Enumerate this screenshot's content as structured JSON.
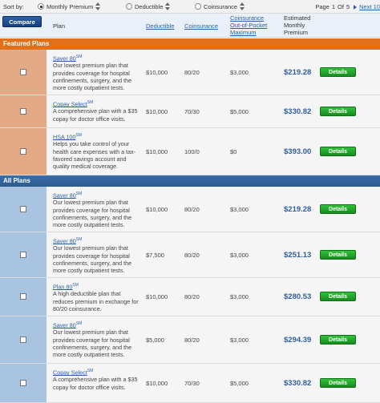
{
  "sortbar": {
    "label": "Sort by:",
    "options": [
      {
        "label": "Monthly Premium",
        "selected": true
      },
      {
        "label": "Deductible",
        "selected": false
      },
      {
        "label": "Coinsurance",
        "selected": false
      }
    ],
    "pager": {
      "page": "Page",
      "current": "1",
      "of": "Of",
      "total": "5",
      "next": "Next 10"
    }
  },
  "header": {
    "compare": "Compare",
    "plan": "Plan",
    "deductible": "Deductible",
    "coinsurance": "Coinsurance",
    "oop": [
      "Coinsurance",
      "Out-of-Pocket",
      "Maximum"
    ],
    "premium": [
      "Estimated",
      "Monthly",
      "Premium"
    ]
  },
  "sections": {
    "featured": "Featured Plans",
    "all": "All Plans"
  },
  "details_label": "Details",
  "featured_rows": [
    {
      "name": "Saver 80",
      "sm": "SM",
      "desc": [
        "Our lowest premium plan that",
        "provides coverage for hospital",
        "confinements, surgery, and the",
        "more costly outpatient tests."
      ],
      "deductible": "$10,000",
      "coinsurance": "80/20",
      "oop": "$3,000",
      "premium": "$219.28"
    },
    {
      "name": "Copay Select",
      "sm": "SM",
      "desc": [
        "A comprehensive plan with a $35",
        "copay for doctor office visits."
      ],
      "deductible": "$10,000",
      "coinsurance": "70/30",
      "oop": "$5,000",
      "premium": "$330.82"
    },
    {
      "name": "HSA 100",
      "sm": "SM",
      "desc": [
        "Helps you take control of your",
        "health care expenses with a tax-",
        "favored savings account and",
        "quality medical coverage."
      ],
      "deductible": "$10,000",
      "coinsurance": "100/0",
      "oop": "$0",
      "premium": "$393.00"
    }
  ],
  "all_rows": [
    {
      "name": "Saver 80",
      "sm": "SM",
      "desc": [
        "Our lowest premium plan that",
        "provides coverage for hospital",
        "confinements, surgery, and the",
        "more costly outpatient tests."
      ],
      "deductible": "$10,000",
      "coinsurance": "80/20",
      "oop": "$3,000",
      "premium": "$219.28"
    },
    {
      "name": "Saver 80",
      "sm": "SM",
      "desc": [
        "Our lowest premium plan that",
        "provides coverage for hospital",
        "confinements, surgery, and the",
        "more costly outpatient tests."
      ],
      "deductible": "$7,500",
      "coinsurance": "80/20",
      "oop": "$3,000",
      "premium": "$251.13"
    },
    {
      "name": "Plan 80",
      "sm": "SM",
      "desc": [
        "A high deductible plan that",
        "reduces premium in exchange for",
        "80/20 coinsurance."
      ],
      "deductible": "$10,000",
      "coinsurance": "80/20",
      "oop": "$3,000",
      "premium": "$280.53"
    },
    {
      "name": "Saver 80",
      "sm": "SM",
      "desc": [
        "Our lowest premium plan that",
        "provides coverage for hospital",
        "confinements, surgery, and the",
        "more costly outpatient tests."
      ],
      "deductible": "$5,000",
      "coinsurance": "80/20",
      "oop": "$3,000",
      "premium": "$294.39"
    },
    {
      "name": "Copay Select",
      "sm": "SM",
      "desc": [
        "A comprehensive plan with a $35",
        "copay for doctor office visits."
      ],
      "deductible": "$10,000",
      "coinsurance": "70/30",
      "oop": "$5,000",
      "premium": "$330.82"
    }
  ]
}
